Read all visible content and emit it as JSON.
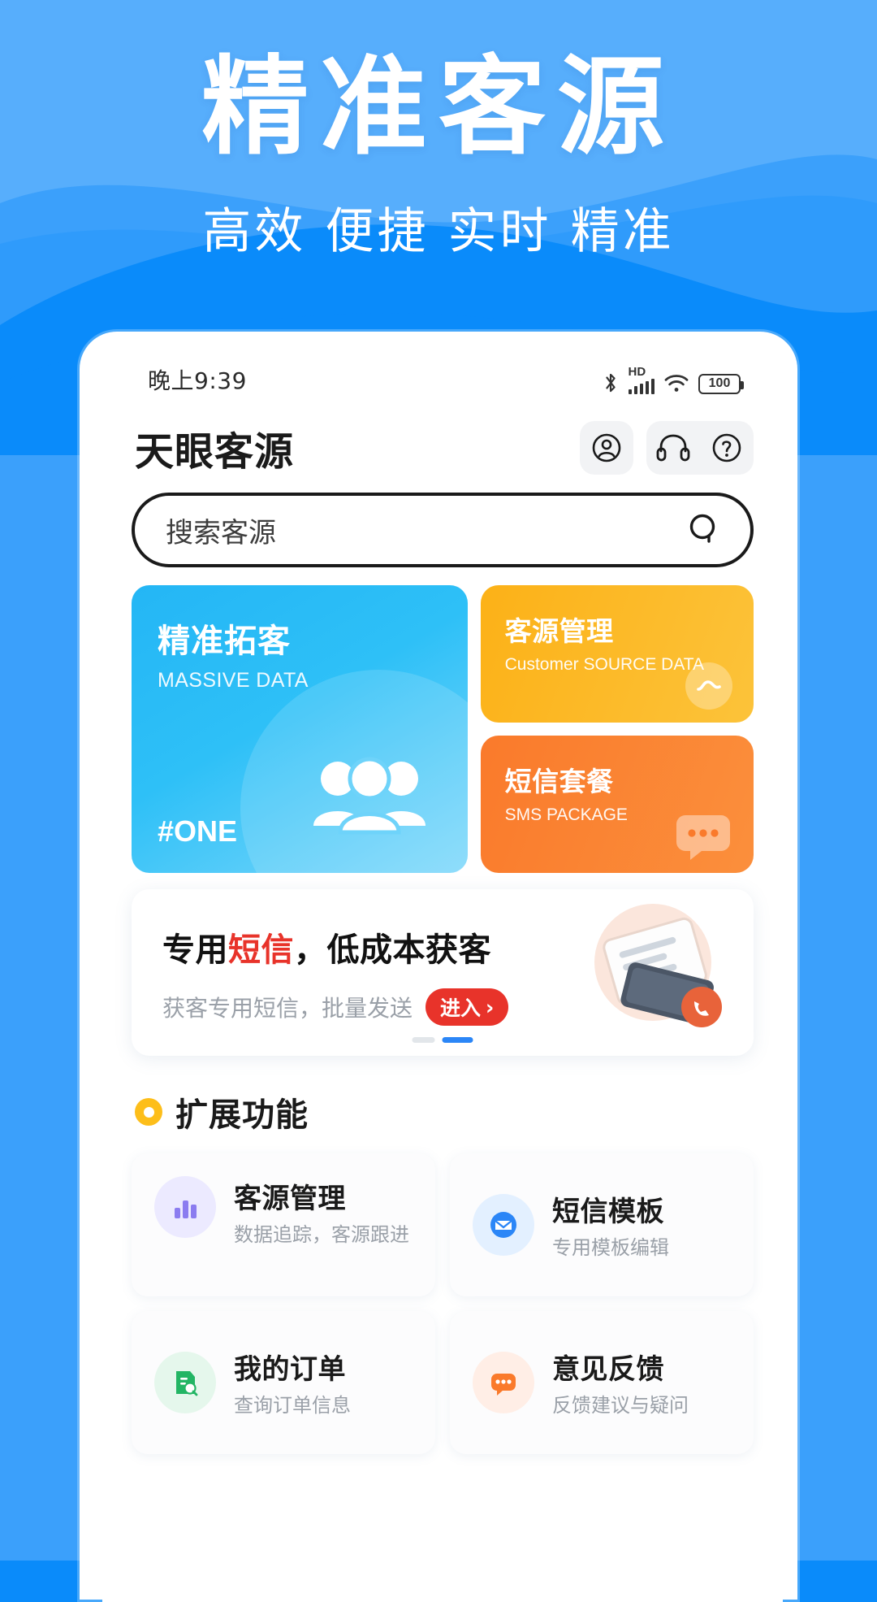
{
  "hero": {
    "title": "精准客源",
    "subtitle": "高效 便捷 实时 精准",
    "bg_color": "#2f9bfb",
    "accent_color": "#0a8bfa"
  },
  "status_bar": {
    "time": "晚上9:39",
    "hd_label": "HD",
    "battery": "100",
    "icons": [
      "bluetooth-icon",
      "signal-icon",
      "wifi-icon",
      "battery-icon"
    ]
  },
  "appbar": {
    "title": "天眼客源",
    "actions": [
      {
        "name": "account-icon"
      },
      {
        "name": "headset-icon"
      },
      {
        "name": "help-icon"
      }
    ]
  },
  "search": {
    "placeholder": "搜索客源",
    "icon": "search-icon"
  },
  "feature_cards": {
    "primary": {
      "title": "精准拓客",
      "subtitle": "MASSIVE DATA",
      "tag": "#ONE",
      "icon": "people-icon",
      "color": "#2ec0f7"
    },
    "secondary": [
      {
        "title": "客源管理",
        "subtitle": "Customer SOURCE DATA",
        "icon": "pulse-icon",
        "color": "#fcb117"
      },
      {
        "title": "短信套餐",
        "subtitle": "SMS PACKAGE",
        "icon": "chat-icon",
        "color": "#fa7a2b"
      }
    ]
  },
  "promo": {
    "title_prefix": "专用",
    "title_highlight": "短信",
    "title_suffix": "，低成本获客",
    "subtitle": "获客专用短信，批量发送",
    "button_label": "进入",
    "button_chevron": "›",
    "highlight_color": "#e8332a",
    "pager": {
      "total": 2,
      "active": 1
    },
    "art_icon": "phone-message-icon"
  },
  "section": {
    "title": "扩展功能",
    "dot_color": "#fdbe1a"
  },
  "ext_items": [
    {
      "title": "客源管理",
      "subtitle": "数据追踪，客源跟进",
      "icon": "chart-icon",
      "icon_bg": "#eceaff",
      "icon_color": "#8b7cf0"
    },
    {
      "title": "短信模板",
      "subtitle": "专用模板编辑",
      "icon": "mail-icon",
      "icon_bg": "#e3f0ff",
      "icon_color": "#2b86f7"
    },
    {
      "title": "我的订单",
      "subtitle": "查询订单信息",
      "icon": "order-icon",
      "icon_bg": "#e5f7ec",
      "icon_color": "#23b564"
    },
    {
      "title": "意见反馈",
      "subtitle": "反馈建议与疑问",
      "icon": "feedback-icon",
      "icon_bg": "#ffeee6",
      "icon_color": "#fa7a2b"
    }
  ]
}
